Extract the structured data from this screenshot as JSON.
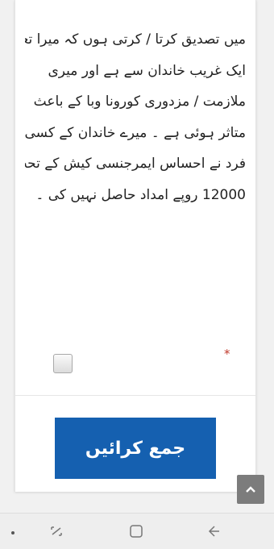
{
  "form": {
    "statement_lines": [
      "میں تصدیق کرتا / کرتی ہوں کہ میرا تعلق",
      "ایک غریب خاندان سے ہے اور میری",
      "ملازمت / مزدوری کورونا وبا کے باعث",
      "متاثر ہوئی ہے ۔ میرے خاندان کے کسی",
      "فرد نے احساس ایمرجنسی کیش کے تحت",
      "12000 روپے امداد حاصل نہیں کی ۔"
    ],
    "required_mark": "*",
    "checkbox_checked": false,
    "submit_label": "جمع کرائیں"
  },
  "colors": {
    "submit_background": "#1560b0",
    "required_mark": "#c0392b",
    "scroll_button": "#7c7c7c"
  },
  "icons": {
    "scroll_top": "chevron-up-icon",
    "navbar": [
      "nav-dot-icon",
      "recent-apps-icon",
      "home-icon",
      "back-icon"
    ]
  }
}
